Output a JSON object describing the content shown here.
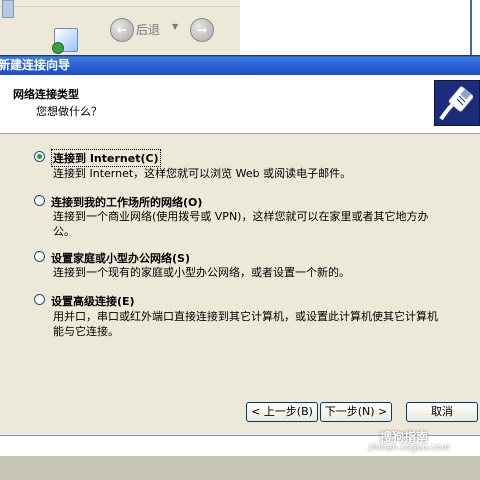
{
  "explorer": {
    "back_label": "后退"
  },
  "wizard": {
    "title": "新建连接向导",
    "header": {
      "title": "网络连接类型",
      "subtitle": "您想做什么？"
    },
    "options": [
      {
        "label": "连接到 Internet(C)",
        "desc": "连接到 Internet，这样您就可以浏览 Web 或阅读电子邮件。",
        "checked": true
      },
      {
        "label": "连接到我的工作场所的网络(O)",
        "desc": "连接到一个商业网络(使用拨号或 VPN)，这样您就可以在家里或者其它地方办公。",
        "checked": false
      },
      {
        "label": "设置家庭或小型办公网络(S)",
        "desc": "连接到一个现有的家庭或小型办公网络，或者设置一个新的。",
        "checked": false
      },
      {
        "label": "设置高级连接(E)",
        "desc": "用并口，串口或红外端口直接连接到其它计算机，或设置此计算机使其它计算机能与它连接。",
        "checked": false
      }
    ],
    "buttons": {
      "back": "< 上一步(B)",
      "next": "下一步(N) >",
      "cancel": "取消"
    }
  },
  "watermark": {
    "text": "搜狗指南",
    "url": "zhinan.sogou.com"
  },
  "colors": {
    "titlebar": "#2a63d6",
    "dialog_bg": "#ece9d8",
    "radio_check": "#21a121"
  }
}
